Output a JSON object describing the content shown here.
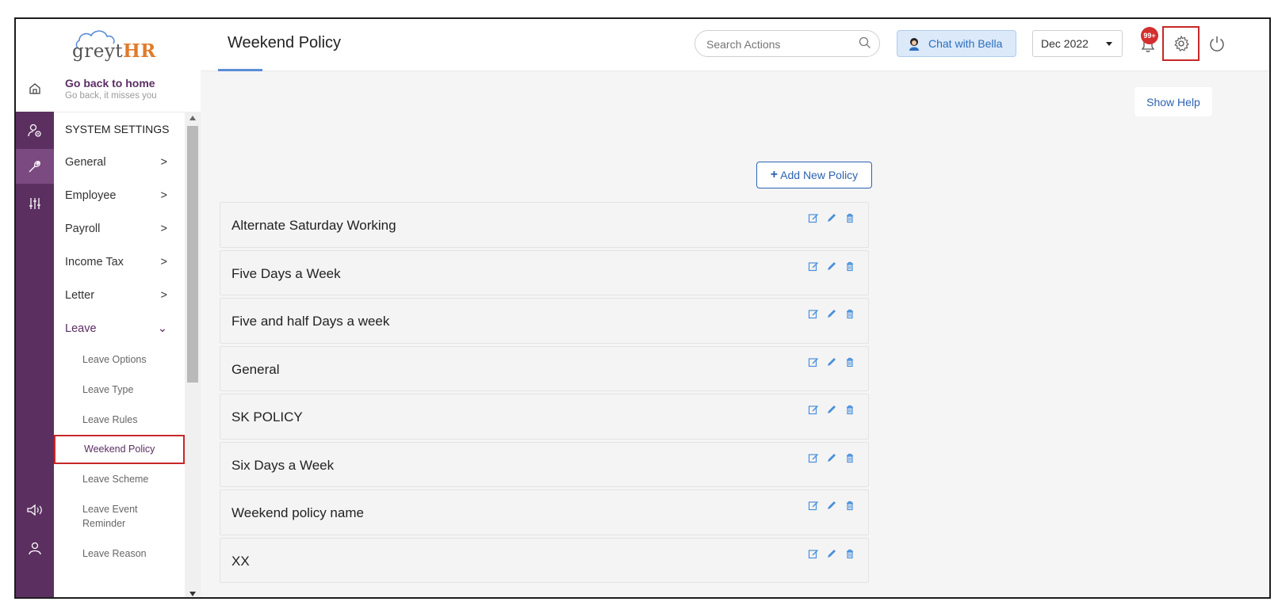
{
  "app": {
    "logo_text": "greytHR",
    "logo_text_grey": "greyt",
    "logo_text_orange": "HR"
  },
  "sidebar": {
    "home_title": "Go back to home",
    "home_subtitle": "Go back, it misses you",
    "section_title": "SYSTEM SETTINGS",
    "items": [
      {
        "label": "General",
        "chevron": ">"
      },
      {
        "label": "Employee",
        "chevron": ">"
      },
      {
        "label": "Payroll",
        "chevron": ">"
      },
      {
        "label": "Income Tax",
        "chevron": ">"
      },
      {
        "label": "Letter",
        "chevron": ">"
      },
      {
        "label": "Leave",
        "chevron": "⌄"
      }
    ],
    "leave_subitems": [
      {
        "label": "Leave Options"
      },
      {
        "label": "Leave Type"
      },
      {
        "label": "Leave Rules"
      },
      {
        "label": "Weekend Policy",
        "active": true
      },
      {
        "label": "Leave Scheme"
      },
      {
        "label": "Leave Event Reminder"
      },
      {
        "label": "Leave Reason"
      }
    ]
  },
  "header": {
    "title": "Weekend Policy",
    "search_placeholder": "Search Actions",
    "chat_label": "Chat with Bella",
    "month_value": "Dec 2022",
    "notification_badge": "99+"
  },
  "main": {
    "show_help_label": "Show Help",
    "add_policy_label": "Add New Policy",
    "add_policy_icon": "+",
    "policies": [
      {
        "name": "Alternate Saturday Working"
      },
      {
        "name": "Five Days a Week"
      },
      {
        "name": "Five and half Days a week"
      },
      {
        "name": "General"
      },
      {
        "name": "SK POLICY"
      },
      {
        "name": "Six Days a Week"
      },
      {
        "name": "Weekend policy name"
      },
      {
        "name": "XX"
      }
    ]
  },
  "colors": {
    "rail": "#5b3060",
    "accent_purple": "#5b2d63",
    "link_blue": "#2d63b0",
    "highlight_red": "#c62828",
    "badge_red": "#d32f2f"
  }
}
